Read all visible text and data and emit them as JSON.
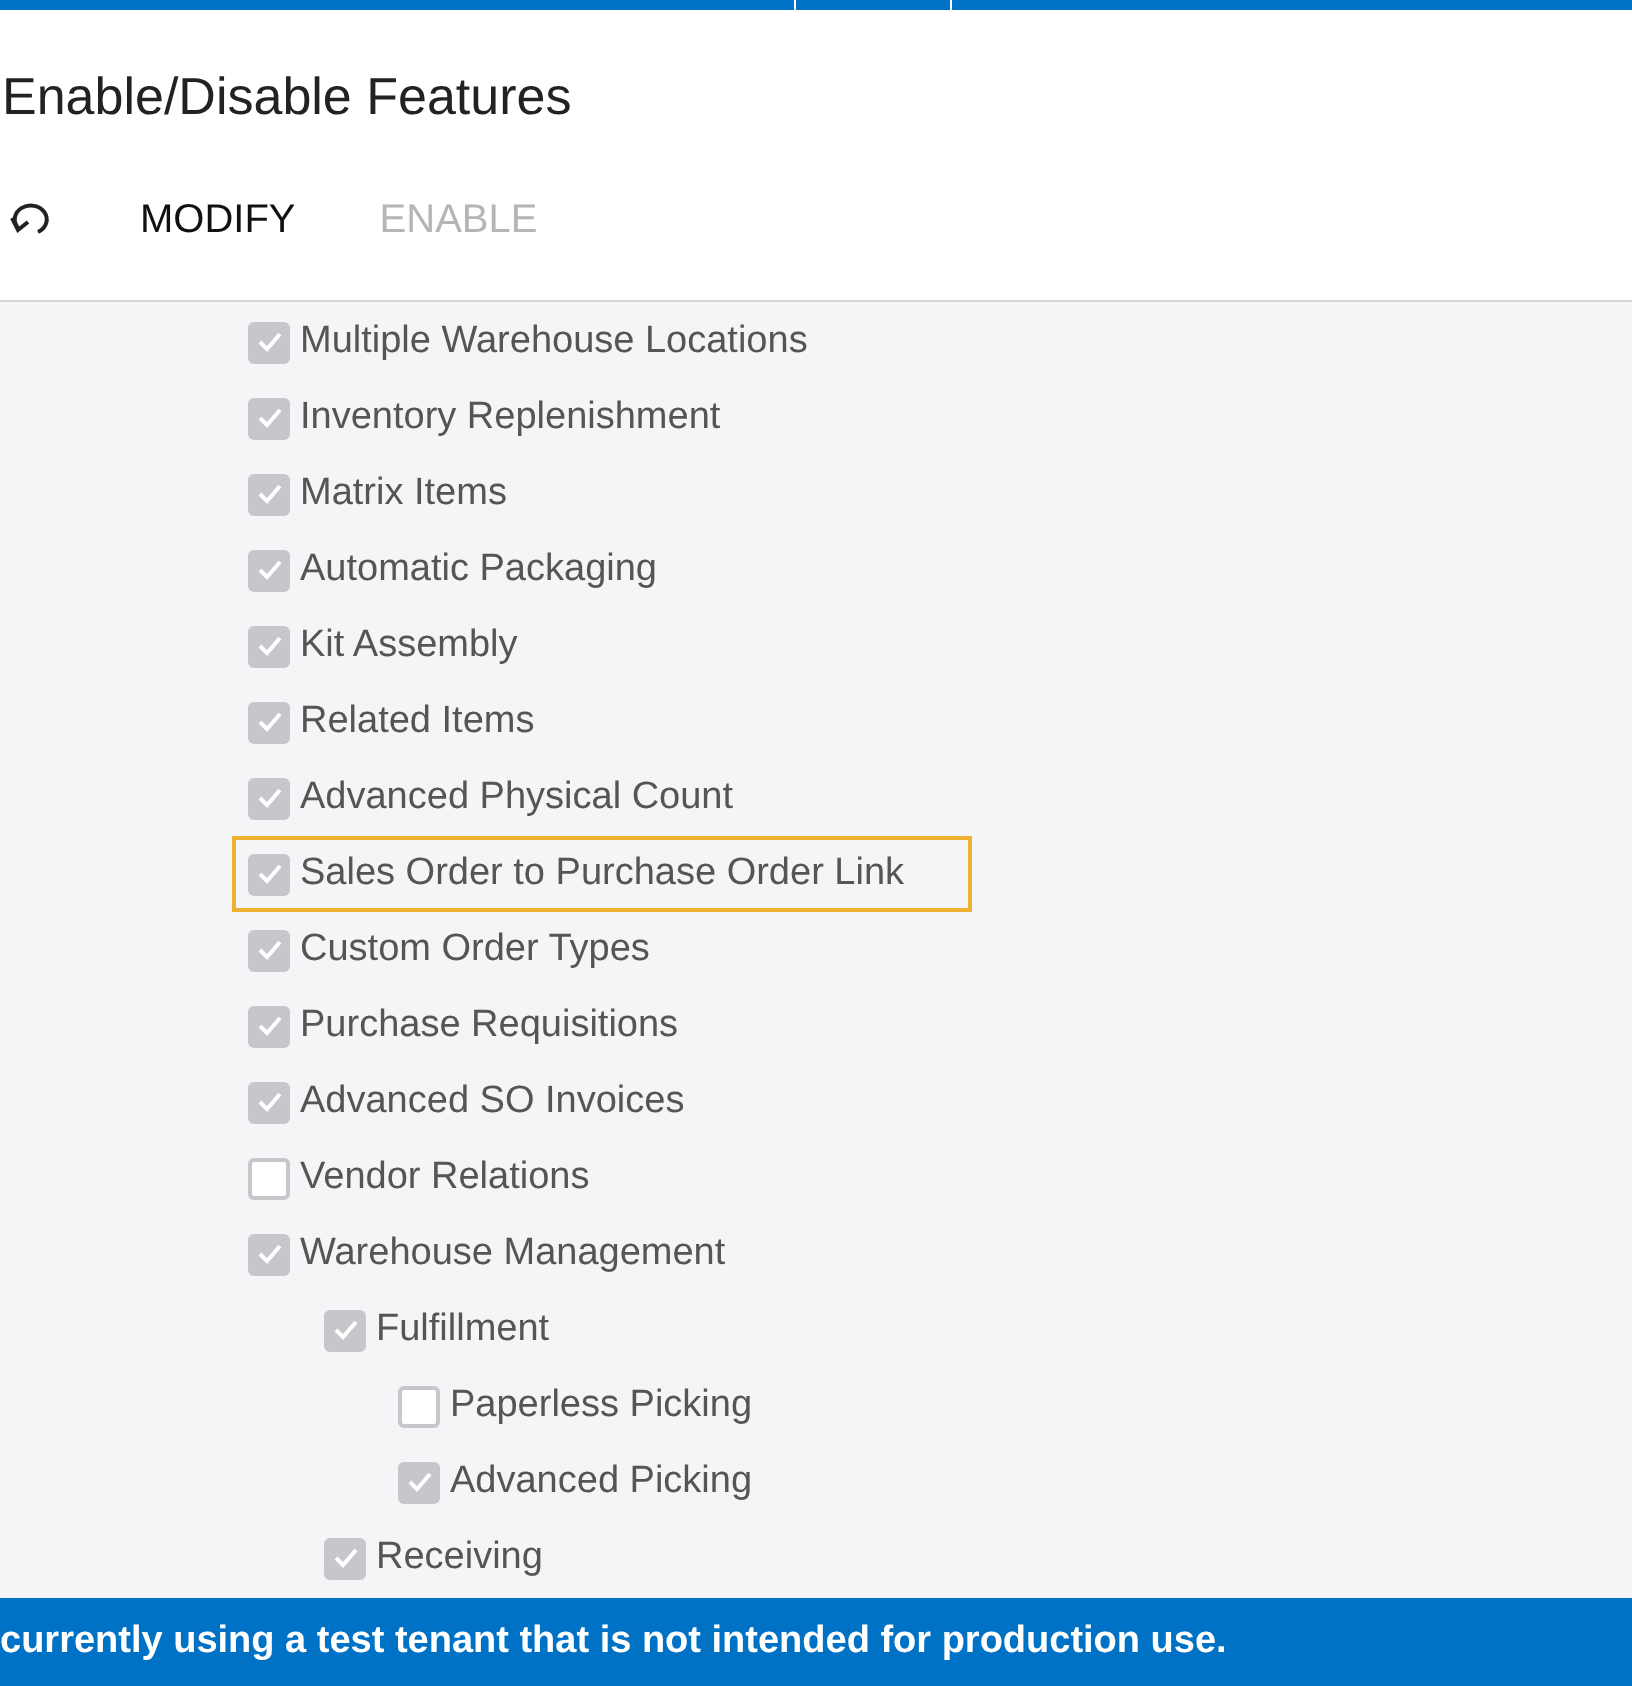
{
  "title": "Enable/Disable Features",
  "toolbar": {
    "modify": {
      "label": "MODIFY",
      "disabled": false
    },
    "enable": {
      "label": "ENABLE",
      "disabled": true
    }
  },
  "features": [
    {
      "label": "Multiple Warehouse Locations",
      "checked": true,
      "highlighted": false
    },
    {
      "label": "Inventory Replenishment",
      "checked": true,
      "highlighted": false
    },
    {
      "label": "Matrix Items",
      "checked": true,
      "highlighted": false
    },
    {
      "label": "Automatic Packaging",
      "checked": true,
      "highlighted": false
    },
    {
      "label": "Kit Assembly",
      "checked": true,
      "highlighted": false
    },
    {
      "label": "Related Items",
      "checked": true,
      "highlighted": false
    },
    {
      "label": "Advanced Physical Count",
      "checked": true,
      "highlighted": false
    },
    {
      "label": "Sales Order to Purchase Order Link",
      "checked": true,
      "highlighted": true
    },
    {
      "label": "Custom Order Types",
      "checked": true,
      "highlighted": false
    },
    {
      "label": "Purchase Requisitions",
      "checked": true,
      "highlighted": false
    },
    {
      "label": "Advanced SO Invoices",
      "checked": true,
      "highlighted": false
    },
    {
      "label": "Vendor Relations",
      "checked": false,
      "highlighted": false
    },
    {
      "label": "Warehouse Management",
      "checked": true,
      "highlighted": false,
      "children": [
        {
          "label": "Fulfillment",
          "checked": true,
          "highlighted": false,
          "children": [
            {
              "label": "Paperless Picking",
              "checked": false,
              "highlighted": false
            },
            {
              "label": "Advanced Picking",
              "checked": true,
              "highlighted": false
            }
          ]
        },
        {
          "label": "Receiving",
          "checked": true,
          "highlighted": false
        }
      ]
    }
  ],
  "banner": "currently using a test tenant that is not intended for production use."
}
